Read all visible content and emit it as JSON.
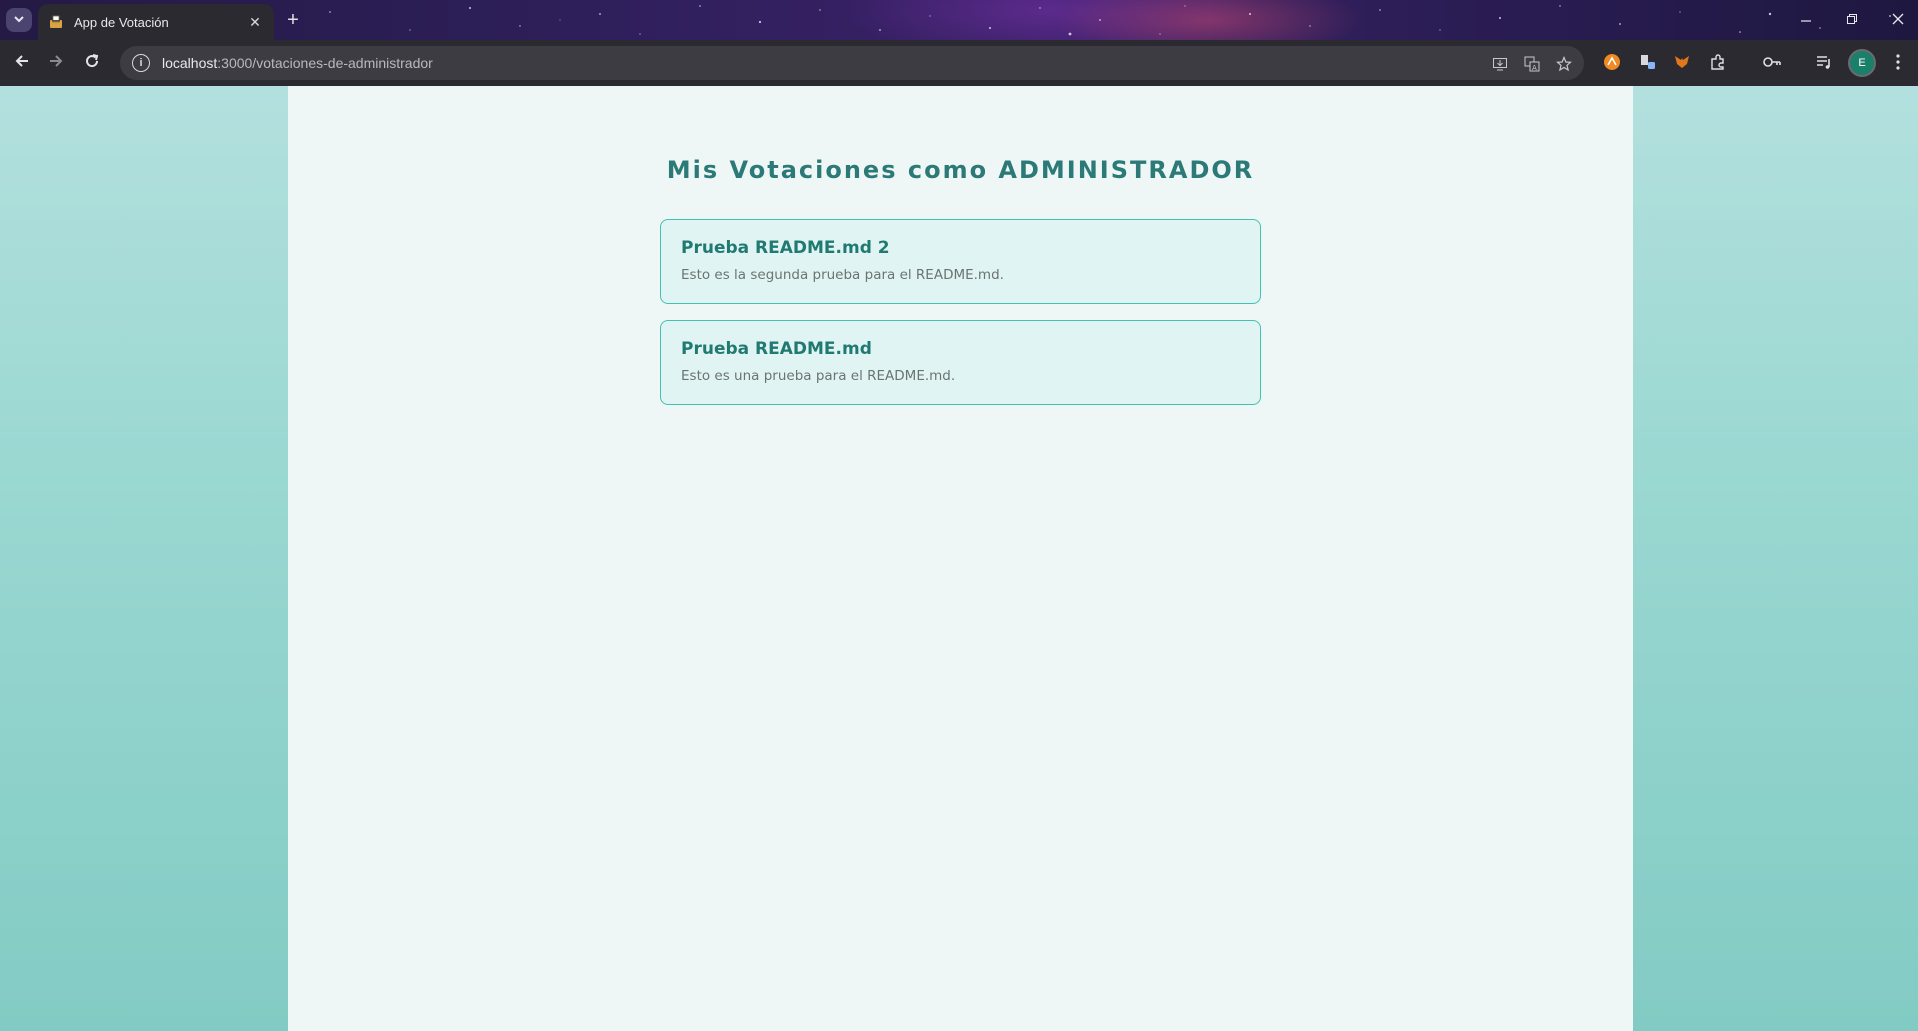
{
  "browser": {
    "tab_title": "App de Votación",
    "new_tab_symbol": "+",
    "tab_close_symbol": "✕",
    "url_host": "localhost",
    "url_rest": ":3000/votaciones-de-administrador",
    "profile_initial": "E",
    "icons": {
      "tab_search": "chevron-down-icon",
      "back": "arrow-left-icon",
      "forward": "arrow-right-icon",
      "reload": "reload-icon",
      "site_info": "info-icon",
      "install": "install-app-icon",
      "translate": "translate-icon",
      "bookmark": "star-icon",
      "extensions": "puzzle-icon",
      "passwords": "key-icon",
      "media": "media-control-icon",
      "menu": "kebab-menu-icon"
    }
  },
  "page": {
    "title": "Mis Votaciones como ADMINISTRADOR",
    "votes": [
      {
        "title": "Prueba README.md 2",
        "description": "Esto es la segunda prueba para el README.md."
      },
      {
        "title": "Prueba README.md",
        "description": "Esto es una prueba para el README.md."
      }
    ]
  },
  "colors": {
    "accent": "#2c7a78",
    "card_border": "#3fc3b3",
    "card_bg": "#e0f5f3",
    "panel_bg": "#eef7f6"
  }
}
